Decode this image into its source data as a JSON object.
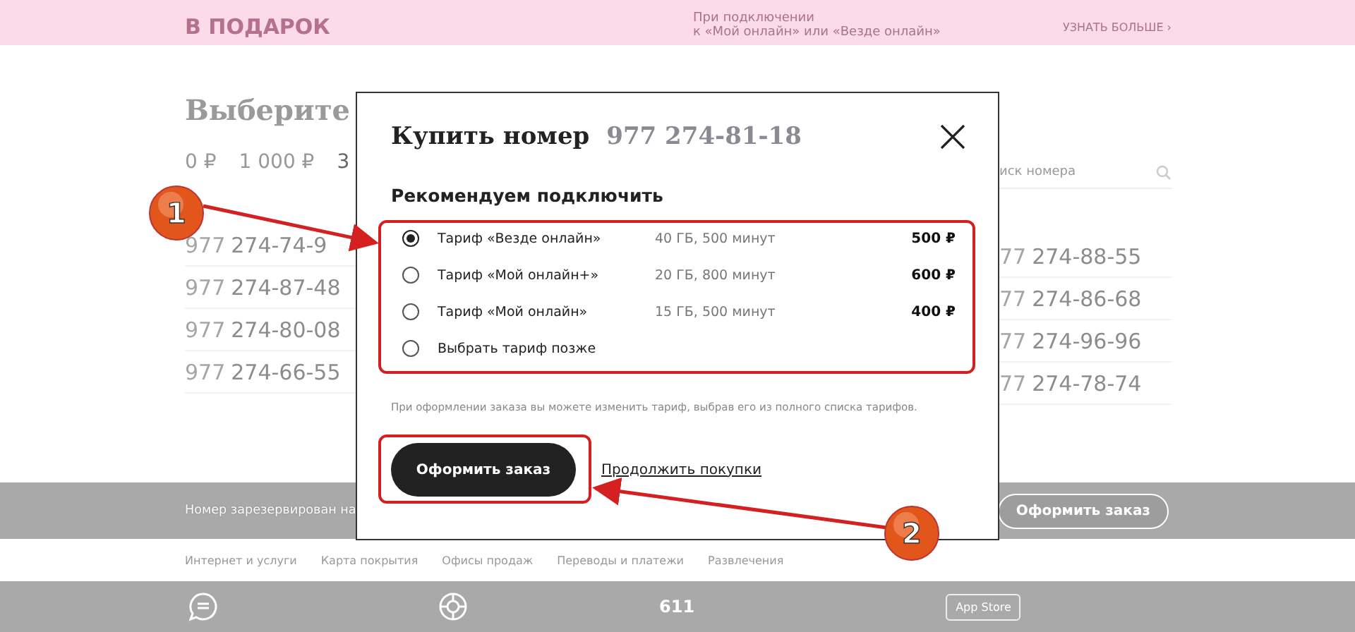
{
  "banner": {
    "title": "В ПОДАРОК",
    "note_lines": [
      "При подключении",
      "к «Мой онлайн» или «Везде онлайн»"
    ],
    "link": "УЗНАТЬ БОЛЬШЕ",
    "link_icon": "›"
  },
  "heading": "Выберите",
  "price_tabs": [
    {
      "label": "0 ₽",
      "selected": false
    },
    {
      "label": "1 000 ₽",
      "selected": false
    },
    {
      "label": "3",
      "selected": true
    }
  ],
  "search": {
    "placeholder": "иск номера"
  },
  "numbers_left": [
    {
      "prefix": "977",
      "number": "274-74-9"
    },
    {
      "prefix": "977",
      "number": "274-87-48"
    },
    {
      "prefix": "977",
      "number": "274-80-08"
    },
    {
      "prefix": "977",
      "number": "274-66-55"
    }
  ],
  "numbers_right": [
    {
      "prefix": "77",
      "number": "274-88-55"
    },
    {
      "prefix": "77",
      "number": "274-86-68"
    },
    {
      "prefix": "77",
      "number": "274-96-96"
    },
    {
      "prefix": "77",
      "number": "274-78-74"
    }
  ],
  "reserve_bar": {
    "text": "Номер зарезервирован на",
    "button": "Оформить заказ"
  },
  "footer_links": [
    "Интернет и услуги",
    "Карта покрытия",
    "Офисы продаж",
    "Переводы и платежи",
    "Развлечения"
  ],
  "footer": {
    "phone": "611",
    "store": "App Store"
  },
  "modal": {
    "title": "Купить номер",
    "number": "977 274-81-18",
    "section": "Рекомендуем подключить",
    "options": [
      {
        "name": "Тариф «Везде онлайн»",
        "details": "40 ГБ, 500 минут",
        "price": "500 ₽",
        "selected": true
      },
      {
        "name": "Тариф «Мой онлайн+»",
        "details": "20 ГБ, 800 минут",
        "price": "600 ₽",
        "selected": false
      },
      {
        "name": "Тариф «Мой онлайн»",
        "details": "15 ГБ, 500 минут",
        "price": "400 ₽",
        "selected": false
      },
      {
        "name": "Выбрать тариф позже",
        "selected": false
      }
    ],
    "note": "При оформлении заказа вы можете изменить тариф, выбрав его из полного списка тарифов.",
    "submit": "Оформить заказ",
    "continue": "Продолжить покупки"
  },
  "annotations": [
    "1",
    "2"
  ]
}
